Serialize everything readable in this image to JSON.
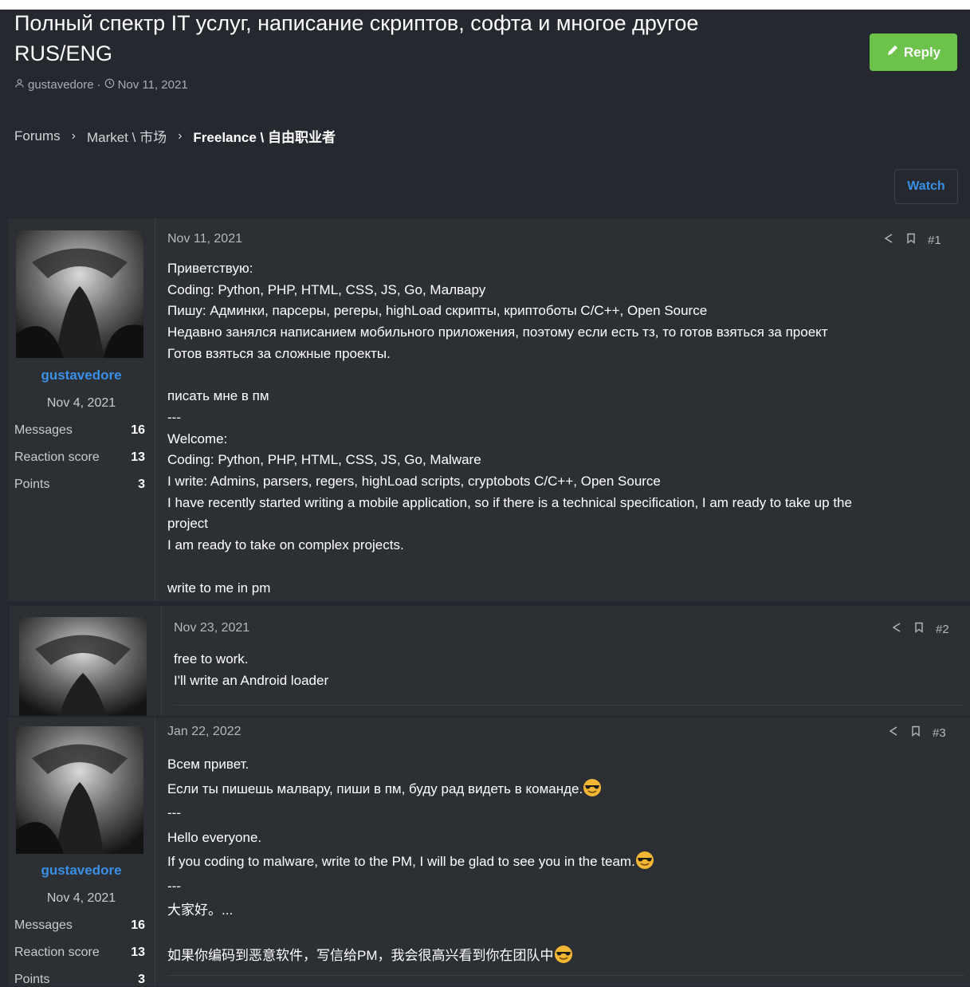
{
  "thread": {
    "title_line1": "Полный спектр IT услуг, написание скриптов, софта и многое другое",
    "title_line2": "RUS/ENG",
    "author": "gustavedore",
    "date": "Nov 11, 2021"
  },
  "breadcrumb": [
    {
      "label": "Forums"
    },
    {
      "label": "Market \\ 市场"
    },
    {
      "label": "Freelance \\ 自由职业者"
    }
  ],
  "buttons": {
    "reply": "Reply",
    "watch": "Watch"
  },
  "colors": {
    "accent_green": "#6cc24a",
    "link_blue": "#3a8fe6",
    "bg": "#25282e",
    "panel": "#2c2f34"
  },
  "user": {
    "name": "gustavedore",
    "joined": "Nov 4, 2021",
    "stats": [
      {
        "label": "Messages",
        "value": "16"
      },
      {
        "label": "Reaction score",
        "value": "13"
      },
      {
        "label": "Points",
        "value": "3"
      }
    ]
  },
  "posts": [
    {
      "date": "Nov 11, 2021",
      "num": "#1",
      "lines": [
        "Приветствую:",
        "Coding: Python, PHP, HTML, CSS, JS, Go, Малвару",
        "Пишу: Админки, парсеры, регеры, highLoad скрипты, криптоботы C/C++, Open Source",
        "Недавно занялся написанием мобильного приложения, поэтому если есть тз, то готов взяться за проект",
        "Готов взяться за сложные проекты.",
        "",
        "писать мне в пм",
        "---",
        "Welcome:",
        "Coding: Python, PHP, HTML, CSS, JS, Go, Malware",
        "I write: Admins, parsers, regers, highLoad scripts, cryptobots C/C++, Open Source",
        "I have recently started writing a mobile application, so if there is a technical specification, I am ready to take up the",
        "project",
        "I am ready to take on complex projects.",
        "",
        "write to me in pm"
      ]
    },
    {
      "date": "Nov 23, 2021",
      "num": "#2",
      "lines": [
        "free to work.",
        "I'll write an Android loader"
      ]
    },
    {
      "date": "Jan 22, 2022",
      "num": "#3",
      "lines": [
        "Всем привет.",
        "Если ты пишешь малвару, пиши в пм, буду рад видеть в команде.",
        "---",
        "Hello everyone.",
        "If you coding to malware, write to the PM, I will be glad to see you in the team.",
        "---",
        "大家好。...",
        "",
        "如果你编码到恶意软件，写信给PM，我会很高兴看到你在团队中"
      ]
    }
  ]
}
